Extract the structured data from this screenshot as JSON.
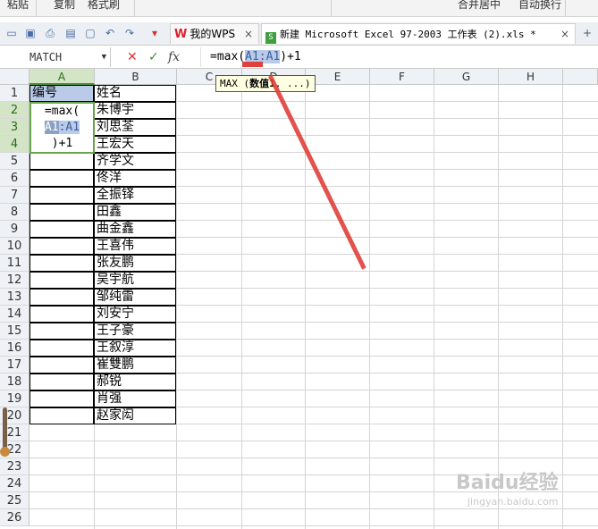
{
  "toolbar": {
    "items": [
      "粘贴",
      "复制",
      "格式刷",
      "合并居中",
      "自动换行"
    ]
  },
  "tabs": {
    "wps_label": "我的WPS",
    "file_label": "新建 Microsoft Excel 97-2003 工作表 (2).xls *",
    "close_glyph": "×"
  },
  "formula_bar": {
    "name_box": "MATCH",
    "fx_label": "fx",
    "formula_prefix": "=max(",
    "formula_ref_a": "A1",
    "formula_colon": ":",
    "formula_ref_b": "A1",
    "formula_suffix": ")+1"
  },
  "tooltip": {
    "func": "MAX",
    "open": " (",
    "arg1": "数值1",
    "rest": ", ...)"
  },
  "columns": [
    "A",
    "B",
    "C",
    "D",
    "E",
    "F",
    "G",
    "H"
  ],
  "rows": [
    "1",
    "2",
    "3",
    "4",
    "5",
    "6",
    "7",
    "8",
    "9",
    "10",
    "11",
    "12",
    "13",
    "14",
    "15",
    "16",
    "17",
    "18",
    "19",
    "20",
    "21",
    "22",
    "23",
    "24",
    "25",
    "26"
  ],
  "cells": {
    "a1": "编号",
    "b_names": [
      "姓名",
      "朱博宇",
      "刘思荃",
      "王宏天",
      "齐学文",
      "佟洋",
      "全振铎",
      "田鑫",
      "曲金鑫",
      "王喜伟",
      "张友鹏",
      "吴宇航",
      "邹纯雷",
      "刘安宁",
      "王子豪",
      "王叙淳",
      "崔雙鹏",
      "郝锐",
      "肖强",
      "赵家闳"
    ]
  },
  "editor": {
    "line1": "=max(",
    "ref_a": "A1",
    "colon": ":",
    "ref_b": "A1",
    "line3": ")+1"
  },
  "watermark": {
    "text": "Baidu经验",
    "sub": "jingyan.baidu.com"
  }
}
